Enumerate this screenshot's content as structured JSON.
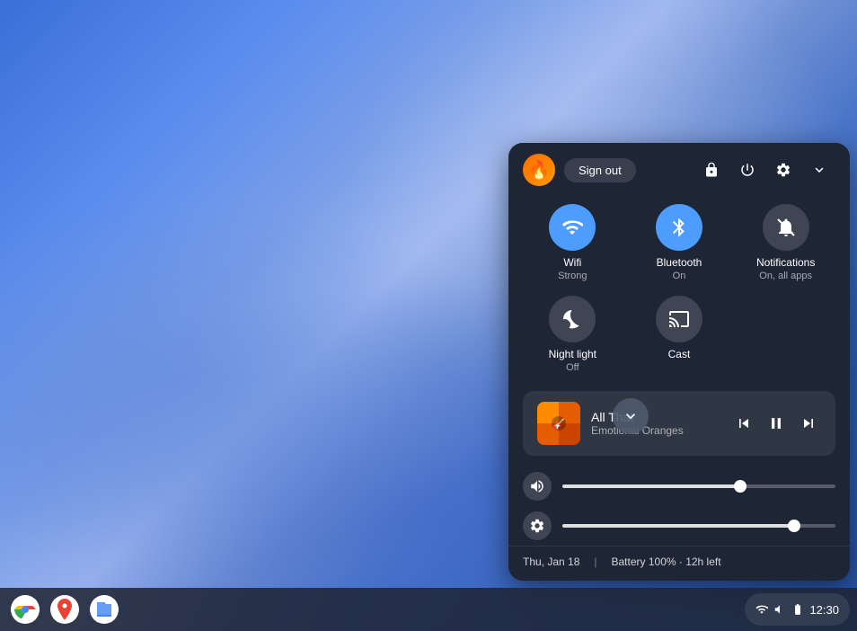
{
  "wallpaper": {
    "alt": "Blue gradient wallpaper"
  },
  "panel": {
    "header": {
      "avatar_emoji": "🔥",
      "sign_out_label": "Sign out",
      "lock_icon": "🔒",
      "power_icon": "⏻",
      "settings_icon": "⚙",
      "collapse_icon": "∨"
    },
    "toggles_row1": [
      {
        "id": "wifi",
        "label": "Wifi",
        "sublabel": "Strong",
        "active": true
      },
      {
        "id": "bluetooth",
        "label": "Bluetooth",
        "sublabel": "On",
        "active": true
      },
      {
        "id": "notifications",
        "label": "Notifications",
        "sublabel": "On, all apps",
        "active": false
      }
    ],
    "toggles_row2": [
      {
        "id": "night_light",
        "label": "Night light",
        "sublabel": "Off",
        "active": false
      },
      {
        "id": "cast",
        "label": "Cast",
        "sublabel": "",
        "active": false
      },
      {
        "id": "empty",
        "label": "",
        "sublabel": "",
        "active": false
      }
    ],
    "media": {
      "title": "All That",
      "artist": "Emotional Oranges",
      "album_art_emoji": "🎨"
    },
    "volume_slider": {
      "icon": "🔊",
      "value": 65
    },
    "brightness_slider": {
      "icon": "⚙",
      "value": 85
    },
    "footer": {
      "date": "Thu, Jan 18",
      "separator": "|",
      "battery": "Battery 100% · 12h left"
    }
  },
  "taskbar": {
    "apps": [
      {
        "name": "Chrome",
        "id": "chrome"
      },
      {
        "name": "Maps",
        "id": "maps"
      },
      {
        "name": "Files",
        "id": "files"
      }
    ],
    "time": "12:30"
  }
}
